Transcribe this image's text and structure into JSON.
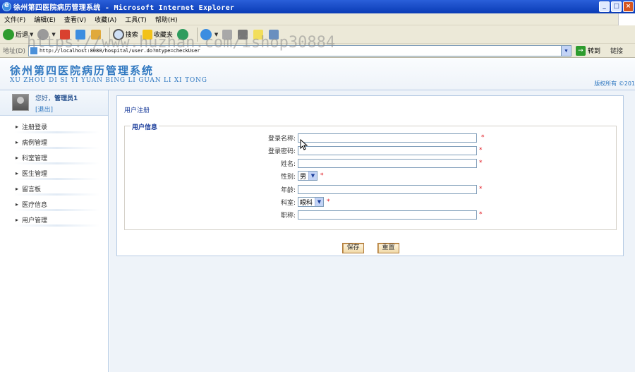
{
  "window": {
    "title": "徐州第四医院病历管理系统 - Microsoft Internet Explorer",
    "buttons": [
      "_",
      "□",
      "×"
    ]
  },
  "menu": [
    "文件(F)",
    "编辑(E)",
    "查看(V)",
    "收藏(A)",
    "工具(T)",
    "帮助(H)"
  ],
  "toolbar": {
    "back": "后退",
    "search": "搜索",
    "favorites": "收藏夹"
  },
  "address": {
    "label": "地址(D)",
    "url": "http://localhost:8080/hospital/user.do?mtype=checkUser",
    "go": "转到",
    "links": "链接"
  },
  "watermark": "https://www.huzhan.com/ishop30884",
  "site": {
    "title": "徐州第四医院病历管理系统",
    "subtitle": "XU ZHOU DI SI YI YUAN BING LI GUAN LI XI TONG",
    "copyright": "版权所有 ©201"
  },
  "user": {
    "greeting": "您好，",
    "name": "管理员1",
    "logout": "[退出]"
  },
  "nav": [
    "注册登录",
    "病例管理",
    "科室管理",
    "医生管理",
    "留言板",
    "医疗信息",
    "用户管理"
  ],
  "page": {
    "breadcrumb": "用户注册",
    "section": "用户信息",
    "required_mark": "*",
    "fields": {
      "login_name": "登录名称:",
      "password": "登录密码:",
      "name": "姓名:",
      "gender": "性别:",
      "age": "年龄:",
      "department": "科室:",
      "title": "职称:"
    },
    "gender_value": "男",
    "department_value": "眼科",
    "save": "保存",
    "reset": "重置"
  }
}
